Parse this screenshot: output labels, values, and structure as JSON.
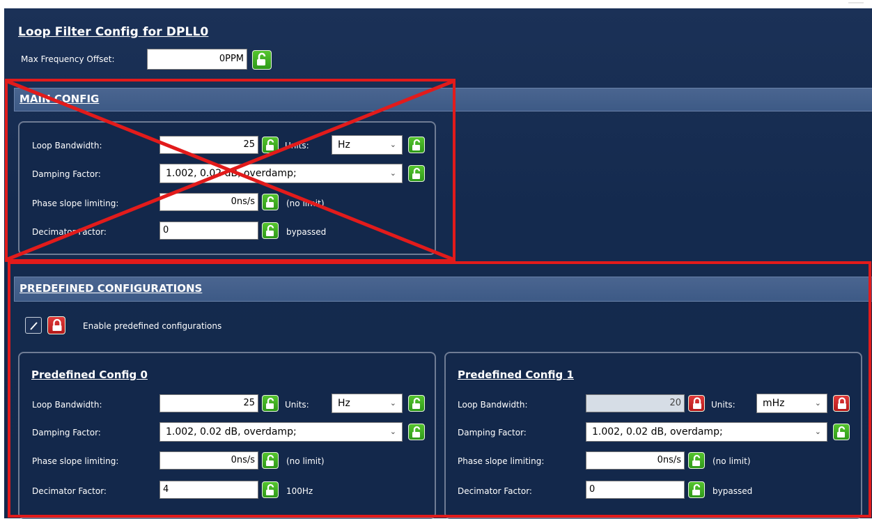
{
  "title": "Loop Filter Config for DPLL0",
  "max_freq": {
    "label": "Max Frequency Offset:",
    "value": "0PPM"
  },
  "main": {
    "header": "MAIN CONFIG",
    "loop_bw_label": "Loop Bandwidth:",
    "loop_bw_value": "25",
    "units_label": "Units:",
    "units_value": "Hz",
    "damping_label": "Damping Factor:",
    "damping_value": "1.002, 0.02 dB, overdamp;",
    "phase_label": "Phase slope limiting:",
    "phase_value": "0ns/s",
    "phase_note": "(no limit)",
    "decim_label": "Decimator Factor:",
    "decim_value": "0",
    "decim_note": "bypassed"
  },
  "predef": {
    "header": "PREDEFINED CONFIGURATIONS",
    "enable_label": "Enable predefined configurations",
    "configs": [
      {
        "title": "Predefined Config 0",
        "loop_bw_label": "Loop Bandwidth:",
        "loop_bw_value": "25",
        "units_label": "Units:",
        "units_value": "Hz",
        "damping_label": "Damping Factor:",
        "damping_value": "1.002, 0.02 dB, overdamp;",
        "phase_label": "Phase slope limiting:",
        "phase_value": "0ns/s",
        "phase_note": "(no limit)",
        "decim_label": "Decimator Factor:",
        "decim_value": "4",
        "decim_note": "100Hz"
      },
      {
        "title": "Predefined Config 1",
        "loop_bw_label": "Loop Bandwidth:",
        "loop_bw_value": "20",
        "units_label": "Units:",
        "units_value": "mHz",
        "damping_label": "Damping Factor:",
        "damping_value": "1.002, 0.02 dB, overdamp;",
        "phase_label": "Phase slope limiting:",
        "phase_value": "0ns/s",
        "phase_note": "(no limit)",
        "decim_label": "Decimator Factor:",
        "decim_value": "0",
        "decim_note": "bypassed"
      }
    ]
  },
  "icons": {
    "unlocked": "lock-open-icon",
    "locked": "lock-closed-icon",
    "edit": "pencil-icon",
    "dropdown": "chevron-down-icon"
  },
  "colors": {
    "background": "#13294c",
    "section_bar": "#3d5a86",
    "lock_green": "#3aab1f",
    "lock_red": "#c92020",
    "annotation_red": "#e21b1b"
  }
}
